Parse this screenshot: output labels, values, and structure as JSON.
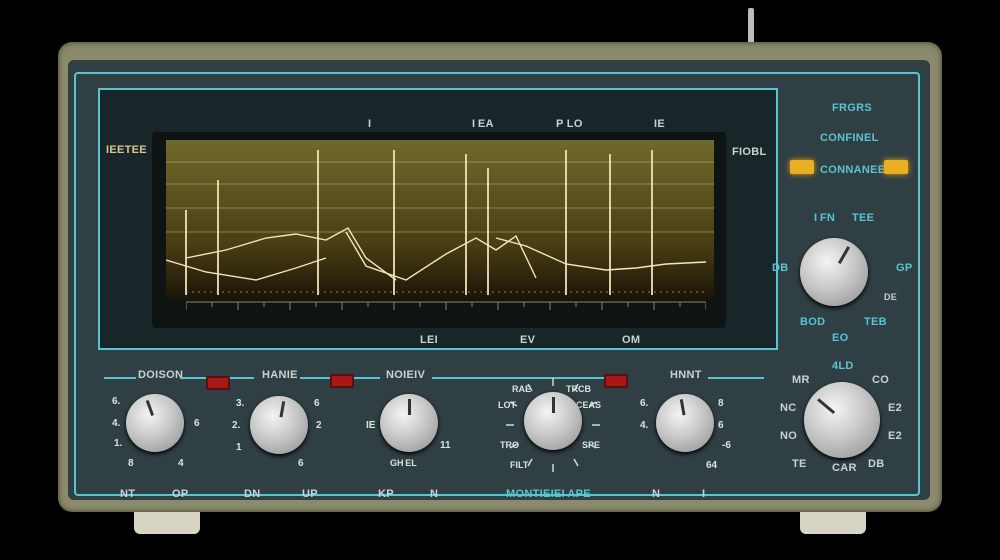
{
  "screen": {
    "top_labels": [
      "I",
      "I EA",
      "P LO",
      "IE"
    ],
    "left_label": "IEETEE",
    "right_label": "FIOBL",
    "bottom_labels": [
      "LEI",
      "EV",
      "OM"
    ]
  },
  "right_panel": {
    "labels": [
      "FRGRS",
      "CONFINEL",
      "CONNANEE"
    ],
    "knob1_labels": [
      "I FN",
      "TEE",
      "GP",
      "DE",
      "BOD",
      "TEB",
      "DB",
      "EO"
    ],
    "knob2_labels": [
      "4LD",
      "MR",
      "CO",
      "NC",
      "E2",
      "NO",
      "E2",
      "TE",
      "CAR",
      "DB"
    ]
  },
  "bottom_sections": {
    "headers": [
      "DOISON",
      "HANIE",
      "NOIEIV",
      "HNNT"
    ],
    "center_label": "MONTIEIEI APE",
    "dials": [
      {
        "ticks": [
          "6.",
          "4.",
          "1.",
          "6",
          "4",
          "8"
        ]
      },
      {
        "ticks": [
          "3.",
          "2.",
          "1",
          "6",
          "2",
          "6"
        ]
      },
      {
        "ticks": [
          "IE",
          "11",
          "GH EL"
        ]
      },
      {
        "ticks": [
          "RAE",
          "TRCB",
          "LOT",
          "CEAS",
          "TRO",
          "SPE",
          "FILT"
        ]
      },
      {
        "ticks": [
          "6.",
          "4.",
          "8",
          "6",
          "-6",
          "64"
        ]
      }
    ],
    "footer_labels": [
      "NT",
      "OP",
      "DN",
      "UP",
      "KP",
      "N",
      "N",
      "I"
    ]
  },
  "colors": {
    "accent": "#58c6d2",
    "case": "#8c8a6c",
    "panel": "#2f3f44",
    "trace": "#e8d8a8",
    "led_amber": "#e8b020",
    "led_red": "#a81818"
  }
}
